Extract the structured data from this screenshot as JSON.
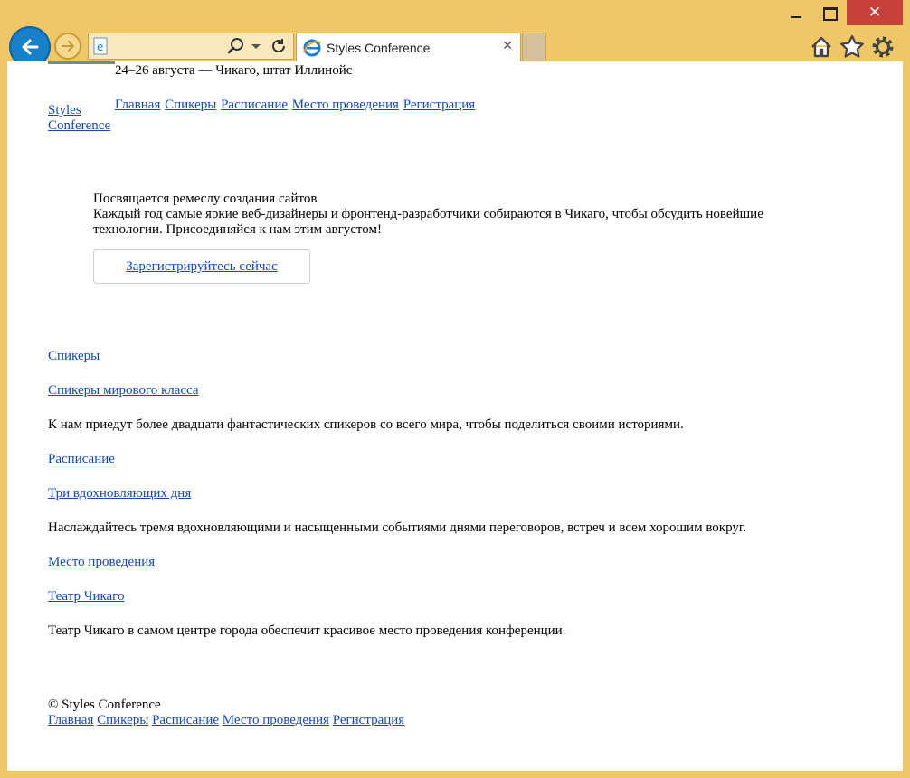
{
  "browser": {
    "address_placeholder": "",
    "tab_title": "Styles Conference",
    "tab_close": "✕",
    "window_close": "✕"
  },
  "page": {
    "event_info": "24–26 августа — Чикаго, штат Иллинойс",
    "logo_line1": "Styles",
    "logo_line2": "Conference",
    "nav": [
      "Главная",
      "Спикеры",
      "Расписание",
      "Место проведения",
      "Регистрация"
    ],
    "hero": {
      "title": "Посвящается ремеслу создания сайтов",
      "desc": "Каждый год самые яркие веб-дизайнеры и фронтенд-разработчики собираются в Чикаго, чтобы обсудить новейшие технологии. Присоединяйся к нам этим августом!",
      "cta": "Зарегистрируйтесь сейчас"
    },
    "sections": [
      {
        "heading": "Спикеры",
        "subheading": "Спикеры мирового класса",
        "text": "К нам приедут более двадцати фантастических спикеров со всего мира, чтобы поделиться своими историями."
      },
      {
        "heading": "Расписание",
        "subheading": "Три вдохновляющих дня",
        "text": "Наслаждайтесь тремя вдохновляющими и насыщенными событиями днями переговоров, встреч и всем хорошим вокруг."
      },
      {
        "heading": "Место проведения",
        "subheading": "Театр Чикаго",
        "text": "Театр Чикаго в самом центре города обеспечит красивое место проведения конференции."
      }
    ],
    "footer": {
      "copyright": "© Styles Conference",
      "nav": [
        "Главная",
        "Спикеры",
        "Расписание",
        "Место проведения",
        "Регистрация"
      ]
    }
  },
  "colors": {
    "frame": "#f0c766",
    "link": "#1048c0",
    "back_button": "#1780c9",
    "close_button": "#c7403a"
  }
}
